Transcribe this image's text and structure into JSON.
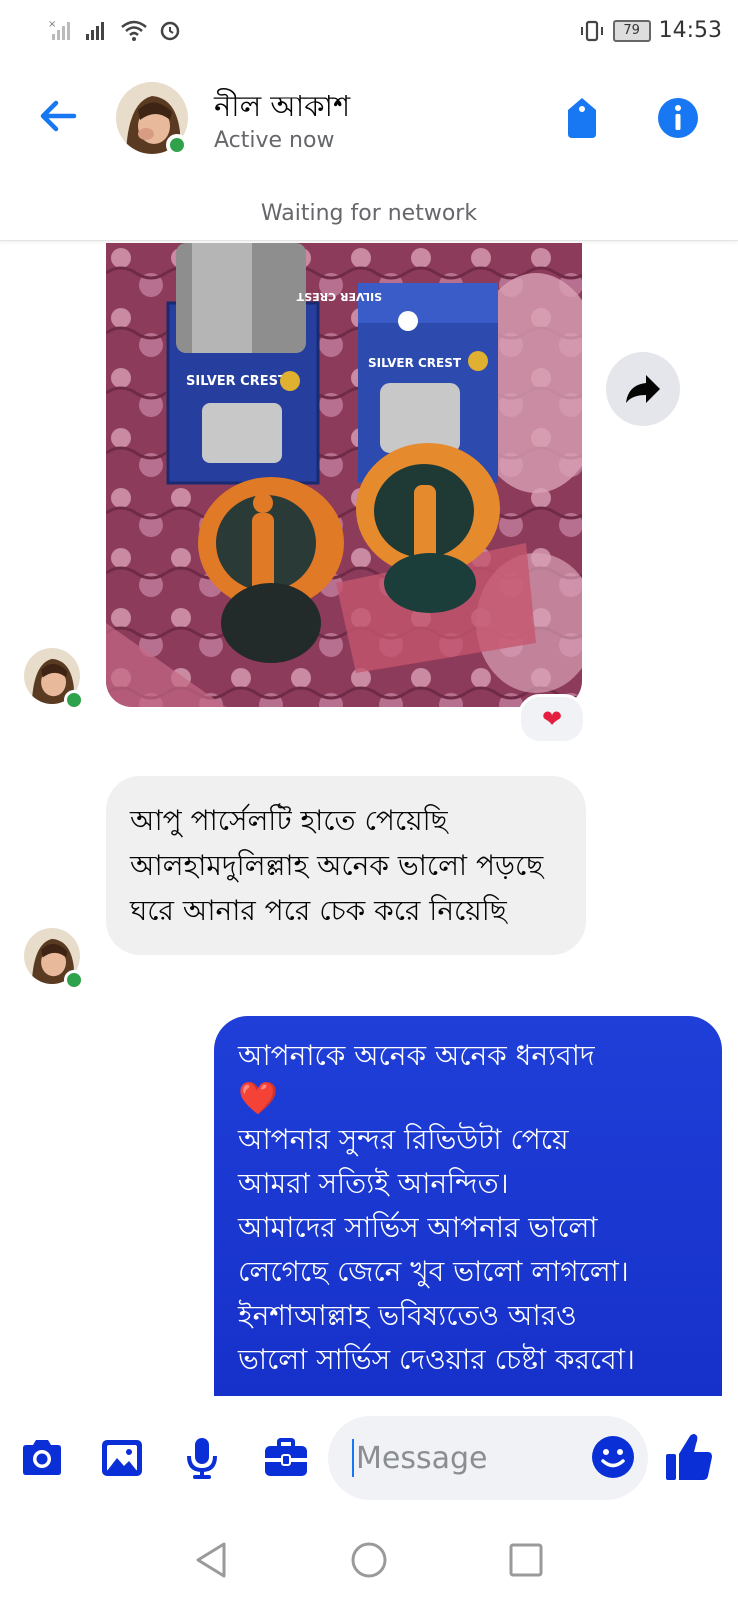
{
  "status_bar": {
    "time": "14:53",
    "battery": "79",
    "icons": [
      "no-sim-icon",
      "signal-icon",
      "wifi-icon",
      "alarm-icon",
      "vibrate-icon",
      "battery-icon"
    ]
  },
  "header": {
    "contact_name": "নীল আকাশ",
    "status": "Active now",
    "icons": [
      "back-arrow-icon",
      "phone-tag-icon",
      "info-icon"
    ]
  },
  "network_banner": "Waiting for network",
  "messages": [
    {
      "type": "photo",
      "from": "contact",
      "photo_text": [
        "SILVER CREST",
        "SILVER CREST",
        "SILVER CREST"
      ],
      "reaction": "❤"
    },
    {
      "type": "text",
      "from": "contact",
      "text": "আপু পার্সেলটি হাতে পেয়েছি আলহামদুলিল্লাহ অনেক ভালো পড়ছে ঘরে আনার পরে চেক করে নিয়েছি"
    },
    {
      "type": "text",
      "from": "me",
      "lines": [
        "আপনাকে অনেক অনেক ধন্যবাদ",
        "❤️",
        "আপনার সুন্দর রিভিউটা পেয়ে",
        "আমরা সত্যিই আনন্দিত।",
        "আমাদের সার্ভিস আপনার ভালো",
        "লেগেছে জেনে খুব ভালো লাগলো।",
        "ইনশাআল্লাহ ভবিষ্যতেও আরও",
        "ভালো সার্ভিস দেওয়ার চেষ্টা করবো।"
      ]
    }
  ],
  "composer": {
    "placeholder": "Message",
    "tools": [
      "camera-icon",
      "gallery-icon",
      "microphone-icon",
      "briefcase-icon"
    ],
    "accent": "#0a2fd6"
  },
  "nav": [
    "back-triangle-icon",
    "home-circle-icon",
    "recents-square-icon"
  ],
  "colors": {
    "messenger_blue": "#1877f2",
    "outgoing_bubble": "#1631c9",
    "online_green": "#31a24c"
  }
}
